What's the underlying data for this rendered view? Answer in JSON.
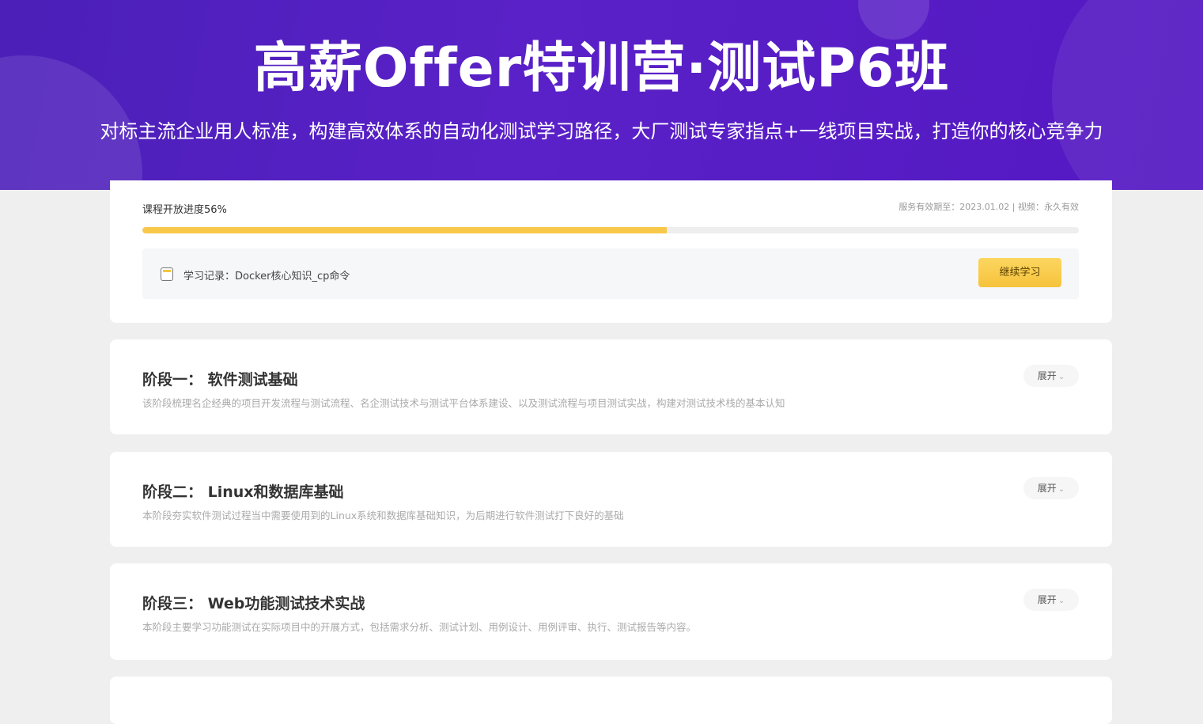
{
  "banner": {
    "title": "高薪Offer特训营·测试P6班",
    "subtitle": "对标主流企业用人标准，构建高效体系的自动化测试学习路径，大厂测试专家指点+一线项目实战，打造你的核心竞争力"
  },
  "progress": {
    "label": "课程开放进度56%",
    "percent": 56,
    "service_info": "服务有效期至：2023.01.02 | 视频：永久有效",
    "bar_color": "#f7c84a"
  },
  "record": {
    "icon": "notebook-icon",
    "text": "学习记录：Docker核心知识_cp命令",
    "continue_label": "继续学习"
  },
  "stages": [
    {
      "title": "阶段一：  软件测试基础",
      "desc": "该阶段梳理名企经典的项目开发流程与测试流程、名企测试技术与测试平台体系建设、以及测试流程与项目测试实战，构建对测试技术栈的基本认知",
      "expand_label": "展开"
    },
    {
      "title": "阶段二：  Linux和数据库基础",
      "desc": "本阶段夯实软件测试过程当中需要使用到的Linux系统和数据库基础知识，为后期进行软件测试打下良好的基础",
      "expand_label": "展开"
    },
    {
      "title": "阶段三：  Web功能测试技术实战",
      "desc": "本阶段主要学习功能测试在实际项目中的开展方式，包括需求分析、测试计划、用例设计、用例评审、执行、测试报告等内容。",
      "expand_label": "展开"
    }
  ],
  "colors": {
    "banner": "#5220c4",
    "accent": "#f6c33c"
  }
}
